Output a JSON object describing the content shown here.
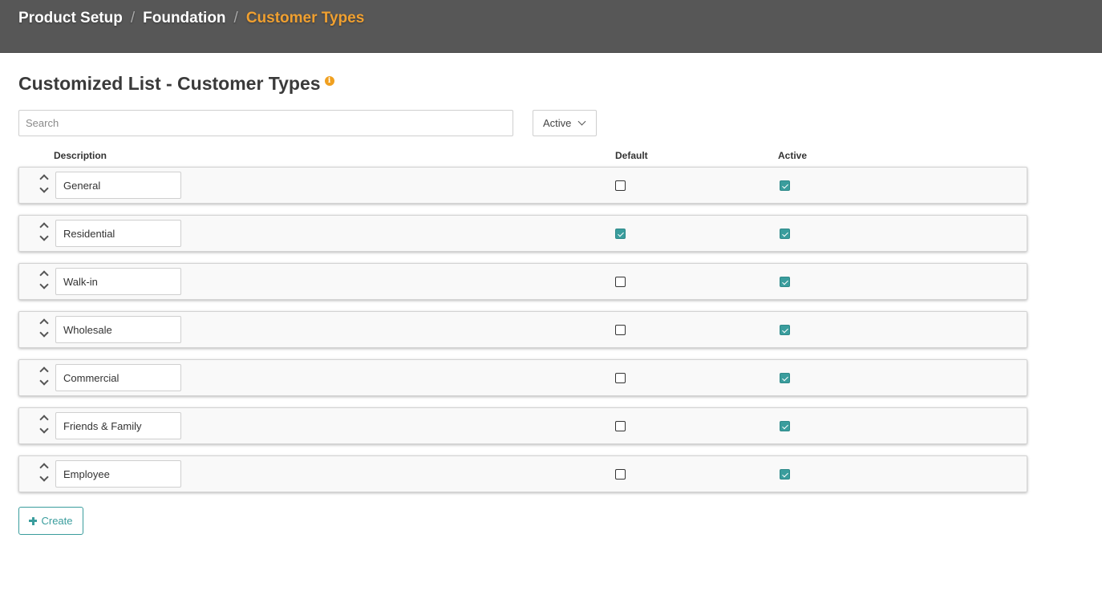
{
  "breadcrumb": {
    "items": [
      "Product Setup",
      "Foundation",
      "Customer Types"
    ],
    "separator": "/"
  },
  "page": {
    "title": "Customized List - Customer Types",
    "info_icon": "info-icon"
  },
  "search": {
    "placeholder": "Search",
    "value": ""
  },
  "filter": {
    "selected": "Active",
    "icon": "chevron-down-icon"
  },
  "table": {
    "headers": {
      "description": "Description",
      "default": "Default",
      "active": "Active"
    },
    "rows": [
      {
        "description": "General",
        "default": false,
        "active": true
      },
      {
        "description": "Residential",
        "default": true,
        "active": true
      },
      {
        "description": "Walk-in",
        "default": false,
        "active": true
      },
      {
        "description": "Wholesale",
        "default": false,
        "active": true
      },
      {
        "description": "Commercial",
        "default": false,
        "active": true
      },
      {
        "description": "Friends & Family",
        "default": false,
        "active": true
      },
      {
        "description": "Employee",
        "default": false,
        "active": true
      }
    ]
  },
  "actions": {
    "create_label": "Create",
    "create_icon": "plus-icon"
  },
  "colors": {
    "header_bg": "#575757",
    "breadcrumb_current": "#f0a030",
    "accent": "#3a9d9d",
    "info": "#f0a020"
  }
}
